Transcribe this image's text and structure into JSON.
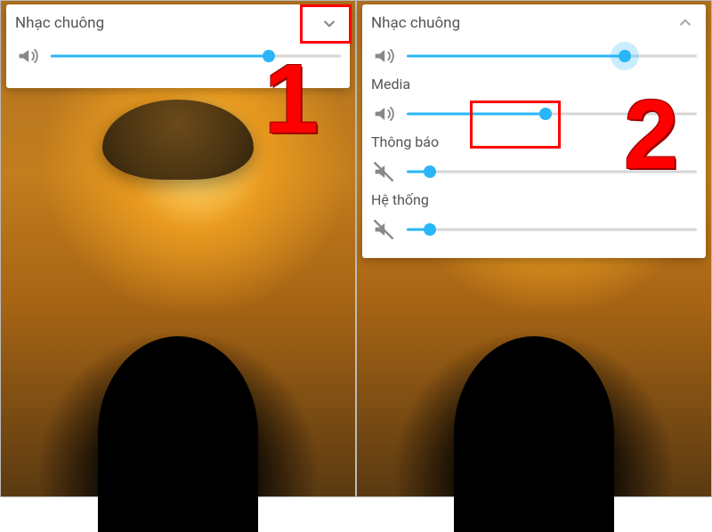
{
  "annotations": {
    "num1": "1",
    "num2": "2"
  },
  "left": {
    "title": "Nhạc chuông",
    "ringtone_pct": 75
  },
  "right": {
    "sections": {
      "ringtone": {
        "label": "Nhạc chuông",
        "pct": 75,
        "active": true
      },
      "media": {
        "label": "Media",
        "pct": 48
      },
      "notify": {
        "label": "Thông báo",
        "pct": 8,
        "muted": true
      },
      "system": {
        "label": "Hệ thống",
        "pct": 8,
        "muted": true
      }
    }
  }
}
